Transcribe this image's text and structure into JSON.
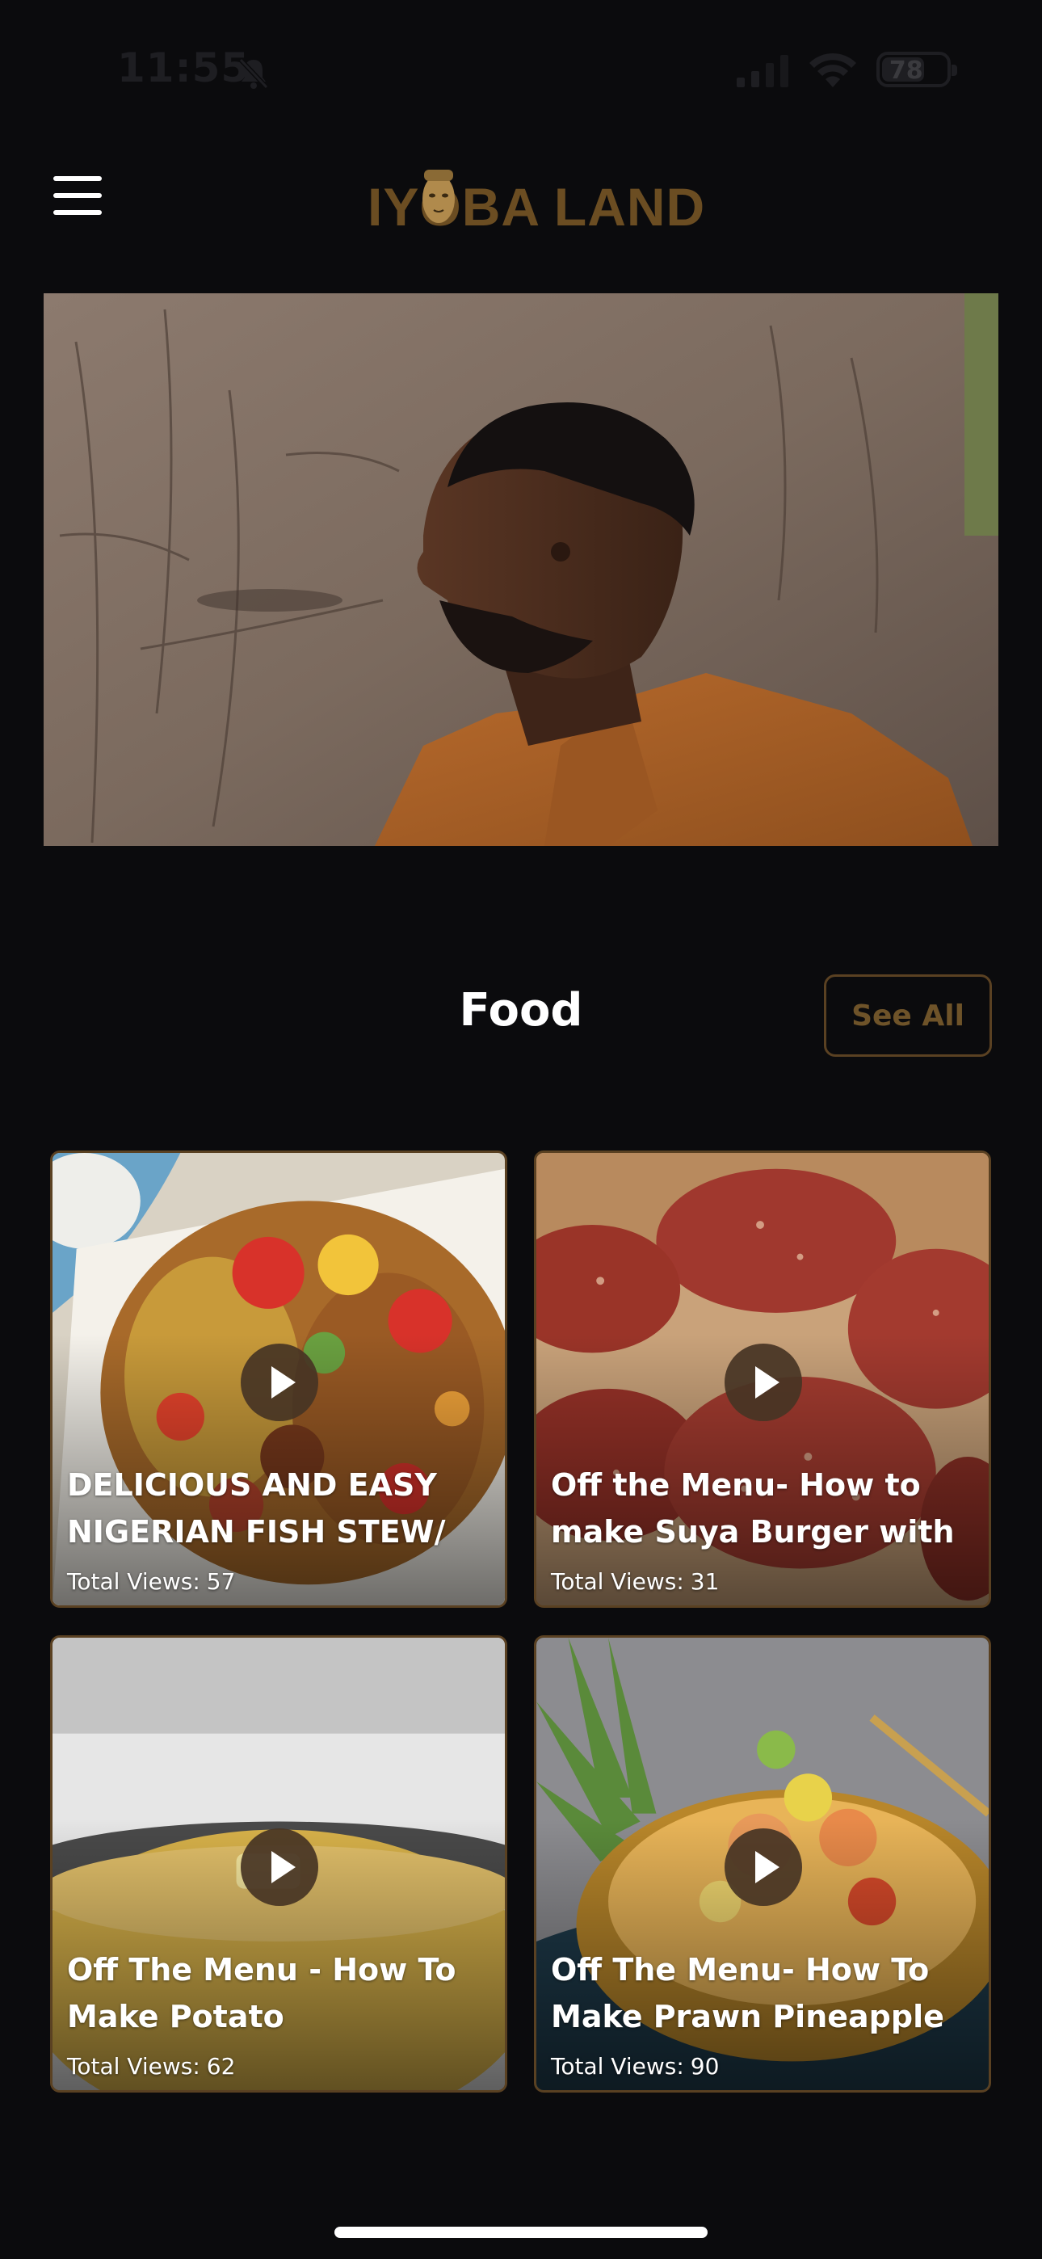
{
  "status_bar": {
    "time": "11:55",
    "battery": "78",
    "battery_level": 0.78
  },
  "header": {
    "logo_text": "IYOBA LAND",
    "menu_icon": "hamburger-menu-icon"
  },
  "section": {
    "title": "Food",
    "see_all_label": "See All"
  },
  "videos": [
    {
      "title": "DELICIOUS AND EASY NIGERIAN FISH STEW/",
      "views_label": "Total Views:",
      "views": "57"
    },
    {
      "title": "Off the Menu- How to make Suya Burger with",
      "views_label": "Total Views:",
      "views": "31"
    },
    {
      "title": "Off The Menu - How To Make Potato",
      "views_label": "Total Views:",
      "views": "62"
    },
    {
      "title": "Off The Menu- How To Make Prawn Pineapple",
      "views_label": "Total Views:",
      "views": "90"
    }
  ],
  "colors": {
    "background": "#0b0b0d",
    "accent_gold": "#6b4d22",
    "card_border": "#5a4122",
    "play_button": "#463424"
  }
}
